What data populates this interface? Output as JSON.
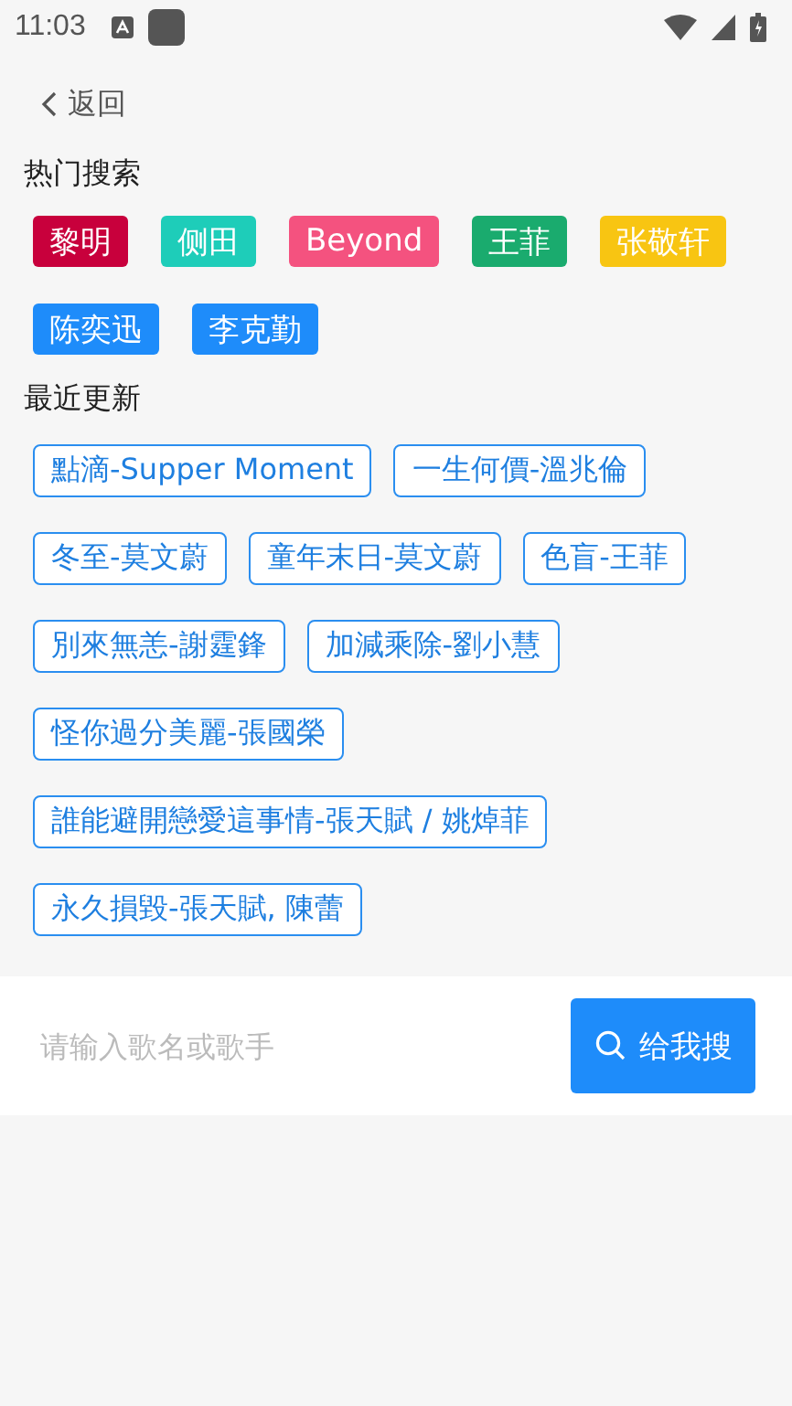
{
  "status_bar": {
    "time": "11:03"
  },
  "back": {
    "label": "返回"
  },
  "hot": {
    "title": "热门搜索",
    "tags": [
      {
        "label": "黎明",
        "color": "#c8003c"
      },
      {
        "label": "侧田",
        "color": "#1ecdb9"
      },
      {
        "label": "Beyond",
        "color": "#f4527f"
      },
      {
        "label": "王菲",
        "color": "#1aab6e"
      },
      {
        "label": "张敬轩",
        "color": "#f8c512"
      },
      {
        "label": "陈奕迅",
        "color": "#1e8cfa"
      },
      {
        "label": "李克勤",
        "color": "#1e8cfa"
      }
    ]
  },
  "recent": {
    "title": "最近更新",
    "items": [
      [
        "點滴-Supper Moment",
        "一生何價-溫兆倫"
      ],
      [
        "冬至-莫文蔚",
        "童年末日-莫文蔚",
        "色盲-王菲"
      ],
      [
        "別來無恙-謝霆鋒",
        "加減乘除-劉小慧"
      ],
      [
        "怪你過分美麗-張國榮"
      ],
      [
        "誰能避開戀愛這事情-張天賦 / 姚焯菲"
      ],
      [
        "永久損毀-張天賦, 陳蕾"
      ]
    ]
  },
  "search": {
    "placeholder": "请输入歌名或歌手",
    "button": "给我搜"
  }
}
